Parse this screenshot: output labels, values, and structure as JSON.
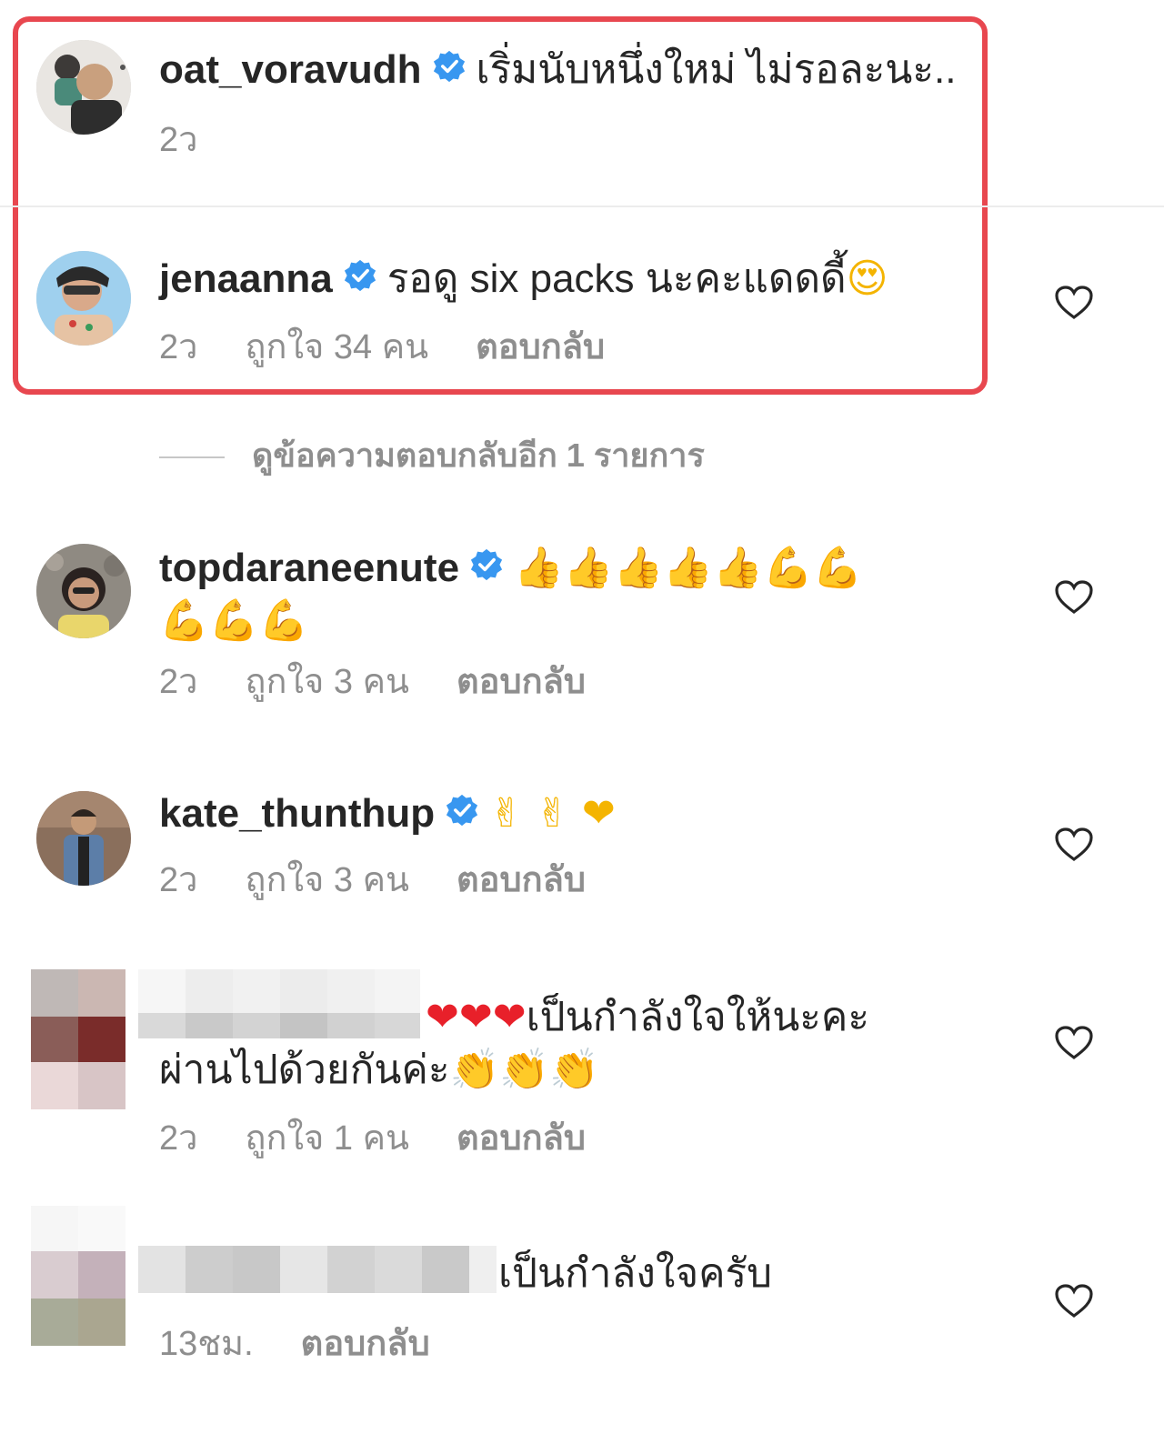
{
  "colors": {
    "highlight": "#e8474f",
    "username": "#262626",
    "meta": "#8e8e8e",
    "verified": "#3897f0"
  },
  "comments": [
    {
      "username": "oat_voravudh",
      "verified": true,
      "text": "เริ่มนับหนึ่งใหม่ ไม่รอละนะ..",
      "time": "2ว",
      "likes": "",
      "reply": "",
      "has_heart": false
    },
    {
      "username": "jenaanna",
      "verified": true,
      "text": "รอดู six packs นะคะแดดดี้",
      "emoji": "😍",
      "time": "2ว",
      "likes": "ถูกใจ 34 คน",
      "reply": "ตอบกลับ",
      "has_heart": true
    },
    {
      "username": "topdaraneenute",
      "verified": true,
      "emoji_line1": "👍👍👍👍👍💪💪",
      "emoji_line2": "💪💪💪",
      "time": "2ว",
      "likes": "ถูกใจ 3 คน",
      "reply": "ตอบกลับ",
      "has_heart": true
    },
    {
      "username": "kate_thunthup",
      "verified": true,
      "emoji": "✌ ✌ ❤",
      "time": "2ว",
      "likes": "ถูกใจ 3 คน",
      "reply": "ตอบกลับ",
      "has_heart": true
    },
    {
      "username": "",
      "verified": false,
      "hearts": "❤❤❤",
      "text_line1": "เป็นกำลังใจให้นะคะ",
      "text_line2": "ผ่านไปด้วยกันค่ะ",
      "emoji_line2": "👏👏👏",
      "time": "2ว",
      "likes": "ถูกใจ 1 คน",
      "reply": "ตอบกลับ",
      "has_heart": true
    },
    {
      "username": "",
      "verified": false,
      "text": "เป็นกำลังใจครับ",
      "time": "13ชม.",
      "likes": "",
      "reply": "ตอบกลับ",
      "has_heart": true
    }
  ],
  "view_replies": "ดูข้อความตอบกลับอีก 1 รายการ"
}
